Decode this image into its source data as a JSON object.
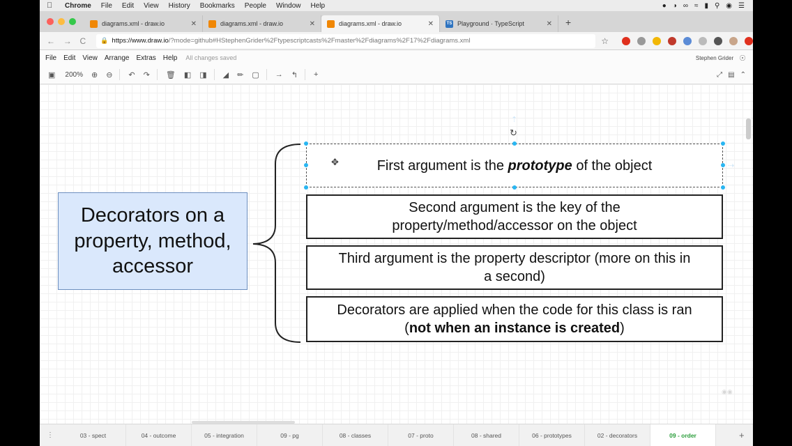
{
  "mac_menu": {
    "app": "Chrome",
    "items": [
      "File",
      "Edit",
      "View",
      "History",
      "Bookmarks",
      "People",
      "Window",
      "Help"
    ]
  },
  "tabs": [
    {
      "title": "diagrams.xml - draw.io",
      "icon": "drawio-icon",
      "active": false
    },
    {
      "title": "diagrams.xml - draw.io",
      "icon": "drawio-icon",
      "active": false
    },
    {
      "title": "diagrams.xml - draw.io",
      "icon": "drawio-icon",
      "active": true
    },
    {
      "title": "Playground · TypeScript",
      "icon": "typescript-icon",
      "active": false
    }
  ],
  "address": {
    "host": "https://www.draw.io",
    "rest": "/?mode=github#HStephenGrider%2Ftypescriptcasts%2Fmaster%2Fdiagrams%2F17%2Fdiagrams.xml"
  },
  "app_menu": {
    "items": [
      "File",
      "Edit",
      "View",
      "Arrange",
      "Extras",
      "Help"
    ],
    "status": "All changes saved",
    "user": "Stephen Grider"
  },
  "toolbar": {
    "zoom": "200%"
  },
  "diagram": {
    "main_lines": [
      "Decorators on a",
      "property, method,",
      "accessor"
    ],
    "box1": {
      "before": "First argument is the ",
      "emph": "prototype",
      "after": " of the object"
    },
    "box2": [
      "Second argument is the key of the",
      "property/method/accessor on the object"
    ],
    "box3": [
      "Third argument is the property descriptor (more on this in",
      "a second)"
    ],
    "box4": {
      "line1": "Decorators are applied when the code for this class is ran",
      "open": "(",
      "bold": "not when an instance is created",
      "close": ")"
    }
  },
  "page_tabs": [
    "03 - spect",
    "04 - outcome",
    "05 - integration",
    "09 - pg",
    "08 - classes",
    "07 - proto",
    "08 - shared",
    "06 - prototypes",
    "02 - decorators",
    "09 - order"
  ],
  "active_page_tab": "09 - order",
  "colors": {
    "main_fill": "#dae8fc",
    "main_stroke": "#6c8ebf",
    "selection": "#29b6f2",
    "active_tab_text": "#2a9d3a"
  }
}
